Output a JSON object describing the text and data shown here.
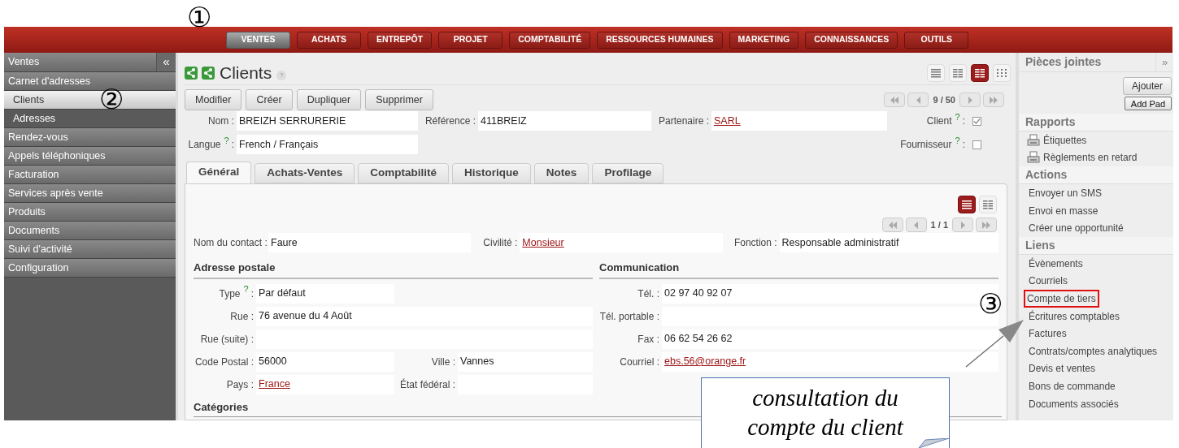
{
  "menu": [
    {
      "label": "VENTES",
      "selected": true
    },
    {
      "label": "ACHATS",
      "selected": false
    },
    {
      "label": "ENTREPÔT",
      "selected": false
    },
    {
      "label": "PROJET",
      "selected": false
    },
    {
      "label": "COMPTABILITÉ",
      "selected": false
    },
    {
      "label": "RESSOURCES HUMAINES",
      "selected": false
    },
    {
      "label": "MARKETING",
      "selected": false
    },
    {
      "label": "CONNAISSANCES",
      "selected": false
    },
    {
      "label": "OUTILS",
      "selected": false
    }
  ],
  "sidebar": {
    "title": "Ventes",
    "collapse": "«",
    "items": [
      {
        "label": "Carnet d'adresses",
        "selected": false,
        "children": [
          {
            "label": "Clients",
            "selected": true
          },
          {
            "label": "Adresses",
            "selected": false
          }
        ]
      },
      {
        "label": "Rendez-vous",
        "selected": false
      },
      {
        "label": "Appels téléphoniques",
        "selected": false
      },
      {
        "label": "Facturation",
        "selected": false
      },
      {
        "label": "Services après vente",
        "selected": false
      },
      {
        "label": "Produits",
        "selected": false
      },
      {
        "label": "Documents",
        "selected": false
      },
      {
        "label": "Suivi d'activité",
        "selected": false
      },
      {
        "label": "Configuration",
        "selected": false
      }
    ]
  },
  "page": {
    "title": "Clients",
    "help": "?",
    "view_modes": [
      {
        "selected": false
      },
      {
        "selected": false
      },
      {
        "selected": true
      },
      {
        "selected": false
      }
    ],
    "buttons": [
      "Modifier",
      "Créer",
      "Dupliquer",
      "Supprimer"
    ],
    "pager": "9 / 50"
  },
  "header_fields": [
    {
      "label": "Nom :",
      "value": "BREIZH SERRURERIE",
      "kind": "text"
    },
    {
      "label": "Référence :",
      "value": "411BREIZ",
      "kind": "text"
    },
    {
      "label": "Partenaire :",
      "value": "SARL",
      "kind": "link"
    }
  ],
  "language": {
    "label": "Langue",
    "help": "?",
    "colon": ":",
    "value": "French / Français"
  },
  "flags": [
    {
      "label": "Client",
      "help": "?",
      "colon": ":",
      "checked": true
    },
    {
      "label": "Fournisseur",
      "help": "?",
      "colon": ":",
      "checked": false
    }
  ],
  "tabs": [
    {
      "label": "Général",
      "selected": true
    },
    {
      "label": "Achats-Ventes",
      "selected": false
    },
    {
      "label": "Comptabilité",
      "selected": false
    },
    {
      "label": "Historique",
      "selected": false
    },
    {
      "label": "Notes",
      "selected": false
    },
    {
      "label": "Profilage",
      "selected": false
    }
  ],
  "contacts": {
    "view_modes": [
      {
        "selected": true
      },
      {
        "selected": false
      }
    ],
    "pager": "1 / 1",
    "fields": [
      {
        "label": "Nom du contact :",
        "value": "Faure",
        "kind": "text"
      },
      {
        "label": "Civilité :",
        "value": "Monsieur",
        "kind": "link"
      },
      {
        "label": "Fonction :",
        "value": "Responsable administratif",
        "kind": "text"
      }
    ]
  },
  "postal": {
    "title": "Adresse postale",
    "rows": [
      [
        {
          "label": "Type",
          "help": "?",
          "colon": ":",
          "value": "Par défaut",
          "kind": "text"
        }
      ],
      [
        {
          "label": "Rue :",
          "value": "76 avenue du 4 Août",
          "kind": "text",
          "wide": true
        }
      ],
      [
        {
          "label": "Rue (suite) :",
          "kind": "text",
          "wide": true
        }
      ],
      [
        {
          "label": "Code Postal :",
          "value": "56000",
          "kind": "text"
        },
        {
          "label": "Ville :",
          "value": "Vannes",
          "kind": "text"
        }
      ],
      [
        {
          "label": "Pays :",
          "value": "France",
          "kind": "link"
        },
        {
          "label": "État fédéral :",
          "kind": "text"
        }
      ]
    ]
  },
  "communication": {
    "title": "Communication",
    "rows": [
      {
        "label": "Tél. :",
        "value": "02 97 40 92 07",
        "kind": "text"
      },
      {
        "label": "Tél. portable :",
        "kind": "text"
      },
      {
        "label": "Fax :",
        "value": "06 62 54 26 62",
        "kind": "text"
      },
      {
        "label": "Courriel :",
        "value": "ebs.56@orange.fr",
        "kind": "link"
      }
    ]
  },
  "categories": {
    "title": "Catégories"
  },
  "right_panel": {
    "title": "Pièces jointes",
    "expand": "»",
    "buttons": [
      "Ajouter",
      "Add Pad"
    ],
    "sections": [
      {
        "title": "Rapports",
        "items": [
          {
            "label": "Étiquettes",
            "kind": "report",
            "highlighted": false
          },
          {
            "label": "Règlements en retard",
            "kind": "report",
            "highlighted": false
          }
        ]
      },
      {
        "title": "Actions",
        "items": [
          {
            "label": "Envoyer un SMS",
            "kind": "link",
            "highlighted": false
          },
          {
            "label": "Envoi en masse",
            "kind": "link",
            "highlighted": false
          },
          {
            "label": "Créer une opportunité",
            "kind": "link",
            "highlighted": false
          }
        ]
      },
      {
        "title": "Liens",
        "items": [
          {
            "label": "Évènements",
            "kind": "link",
            "highlighted": false
          },
          {
            "label": "Courriels",
            "kind": "link",
            "highlighted": false
          },
          {
            "label": "Compte de tiers",
            "kind": "link",
            "highlighted": true
          },
          {
            "label": "Écritures comptables",
            "kind": "link",
            "highlighted": false
          },
          {
            "label": "Factures",
            "kind": "link",
            "highlighted": false
          },
          {
            "label": "Contrats/comptes analytiques",
            "kind": "link",
            "highlighted": false
          },
          {
            "label": "Devis et ventes",
            "kind": "link",
            "highlighted": false
          },
          {
            "label": "Bons de commande",
            "kind": "link",
            "highlighted": false
          },
          {
            "label": "Documents associés",
            "kind": "link",
            "highlighted": false
          }
        ]
      }
    ]
  },
  "annotations": {
    "markers": [
      "①",
      "②",
      "③"
    ],
    "callout": [
      "consultation du",
      "compte du client"
    ]
  }
}
